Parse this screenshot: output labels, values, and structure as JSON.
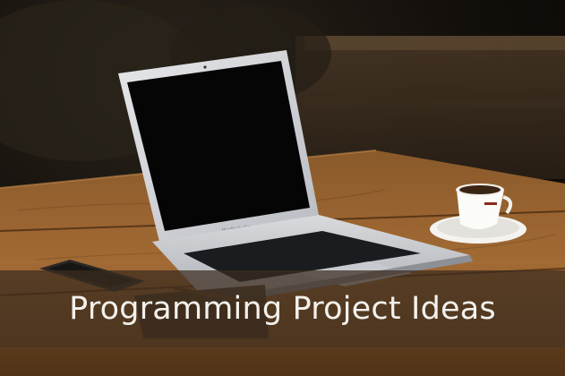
{
  "caption": {
    "title": "Programming Project Ideas"
  },
  "laptop": {
    "brand_text": "MacBook Air"
  }
}
